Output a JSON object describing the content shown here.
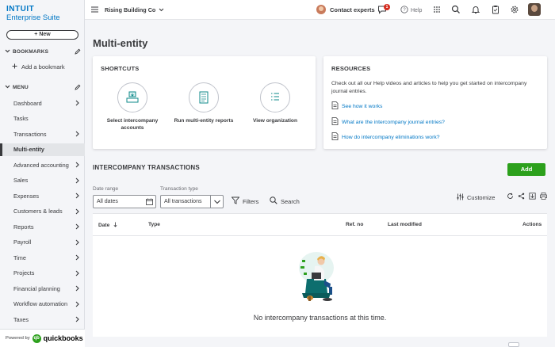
{
  "brand": {
    "line1": "INTUIT",
    "line2": "Enterprise Suite"
  },
  "sidebar": {
    "new_label": "+ New",
    "bookmarks_header": "BOOKMARKS",
    "add_bookmark": "Add a bookmark",
    "menu_header": "MENU",
    "items": [
      {
        "label": "Dashboard",
        "has_arrow": true
      },
      {
        "label": "Tasks",
        "has_arrow": false
      },
      {
        "label": "Transactions",
        "has_arrow": true
      },
      {
        "label": "Multi-entity",
        "has_arrow": false,
        "active": true
      },
      {
        "label": "Advanced accounting",
        "has_arrow": true
      },
      {
        "label": "Sales",
        "has_arrow": true
      },
      {
        "label": "Expenses",
        "has_arrow": true
      },
      {
        "label": "Customers & leads",
        "has_arrow": true
      },
      {
        "label": "Reports",
        "has_arrow": true
      },
      {
        "label": "Payroll",
        "has_arrow": true
      },
      {
        "label": "Time",
        "has_arrow": true
      },
      {
        "label": "Projects",
        "has_arrow": true
      },
      {
        "label": "Financial planning",
        "has_arrow": true
      },
      {
        "label": "Workflow automation",
        "has_arrow": true
      },
      {
        "label": "Taxes",
        "has_arrow": true
      }
    ],
    "powered_by": "Powered by",
    "qb_word": "quickbooks"
  },
  "topbar": {
    "company": "Rising Building Co",
    "contact": "Contact experts",
    "notification_count": "1",
    "help": "Help"
  },
  "page": {
    "title": "Multi-entity"
  },
  "shortcuts": {
    "title": "SHORTCUTS",
    "items": [
      {
        "label": "Select intercompany accounts"
      },
      {
        "label": "Run multi-entity reports"
      },
      {
        "label": "View organization"
      }
    ]
  },
  "resources": {
    "title": "RESOURCES",
    "text": "Check out all our Help videos and articles to help you get started on intercompany journal entries.",
    "links": [
      "See how it works",
      "What are the intercompany journal entries?",
      "How do intercompany eliminations work?"
    ]
  },
  "transactions": {
    "title": "INTERCOMPANY TRANSACTIONS",
    "add_label": "Add",
    "date_range_label": "Date range",
    "date_range_value": "All dates",
    "type_label": "Transaction type",
    "type_value": "All transactions",
    "filters": "Filters",
    "search": "Search",
    "customize": "Customize",
    "columns": [
      "Date",
      "Type",
      "Ref. no",
      "Last modified",
      "Actions"
    ],
    "empty": "No intercompany transactions at this time."
  },
  "colors": {
    "accent_green": "#2ca01c",
    "link_blue": "#0077c5",
    "text": "#393a3d"
  }
}
